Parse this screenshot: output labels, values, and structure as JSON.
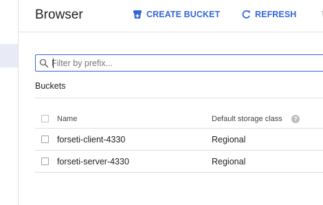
{
  "header": {
    "title": "Browser",
    "create_bucket_label": "CREATE BUCKET",
    "refresh_label": "REFRESH",
    "accent_color": "#3367d6"
  },
  "filter": {
    "placeholder": "Filter by prefix..."
  },
  "section_title": "Buckets",
  "table": {
    "columns": [
      "Name",
      "Default storage class"
    ],
    "rows": [
      {
        "name": "forseti-client-4330",
        "storage_class": "Regional"
      },
      {
        "name": "forseti-server-4330",
        "storage_class": "Regional"
      }
    ]
  },
  "icons": {
    "create": "add-bucket-icon",
    "refresh": "refresh-icon",
    "delete": "delete-icon",
    "search": "search-icon",
    "help": "help-icon"
  }
}
